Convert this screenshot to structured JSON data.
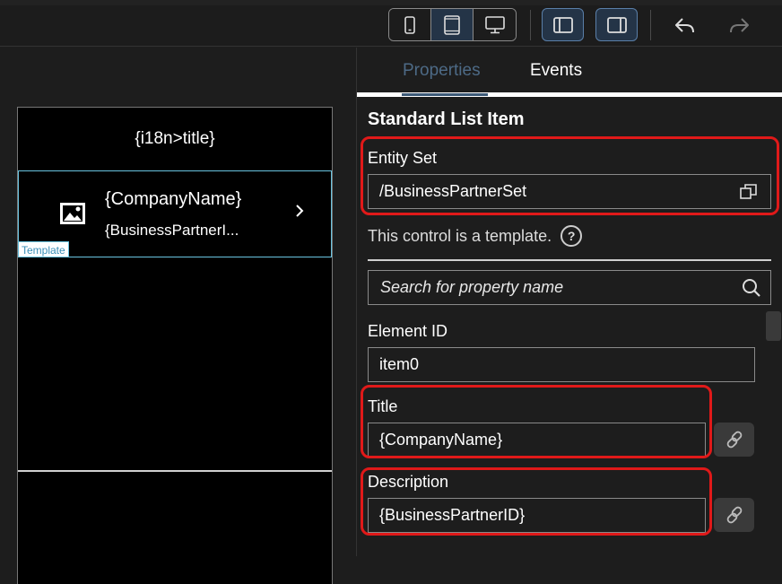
{
  "toolbar": {
    "device_buttons": [
      "phone-icon",
      "tablet-icon",
      "desktop-icon"
    ],
    "active_device": "tablet",
    "panel_toggles": [
      "left-panel-icon",
      "right-panel-icon"
    ],
    "undo": "undo-icon",
    "redo": "redo-icon"
  },
  "preview": {
    "title": "{i18n>title}",
    "list_item": {
      "title": "{CompanyName}",
      "description": "{BusinessPartnerI...",
      "template_tag": "Template"
    }
  },
  "panel": {
    "tabs": [
      {
        "label": "Properties",
        "active": true
      },
      {
        "label": "Events",
        "active": false
      }
    ],
    "section_title": "Standard List Item",
    "entity_set": {
      "label": "Entity Set",
      "value": "/BusinessPartnerSet"
    },
    "template_note": "This control is a template.",
    "search": {
      "placeholder": "Search for property name"
    },
    "element_id": {
      "label": "Element ID",
      "value": "item0"
    },
    "title": {
      "label": "Title",
      "value": "{CompanyName}"
    },
    "description": {
      "label": "Description",
      "value": "{BusinessPartnerID}"
    }
  },
  "colors": {
    "highlight": "#e01919",
    "accent": "#69c3e0",
    "active_bg": "#243447"
  }
}
